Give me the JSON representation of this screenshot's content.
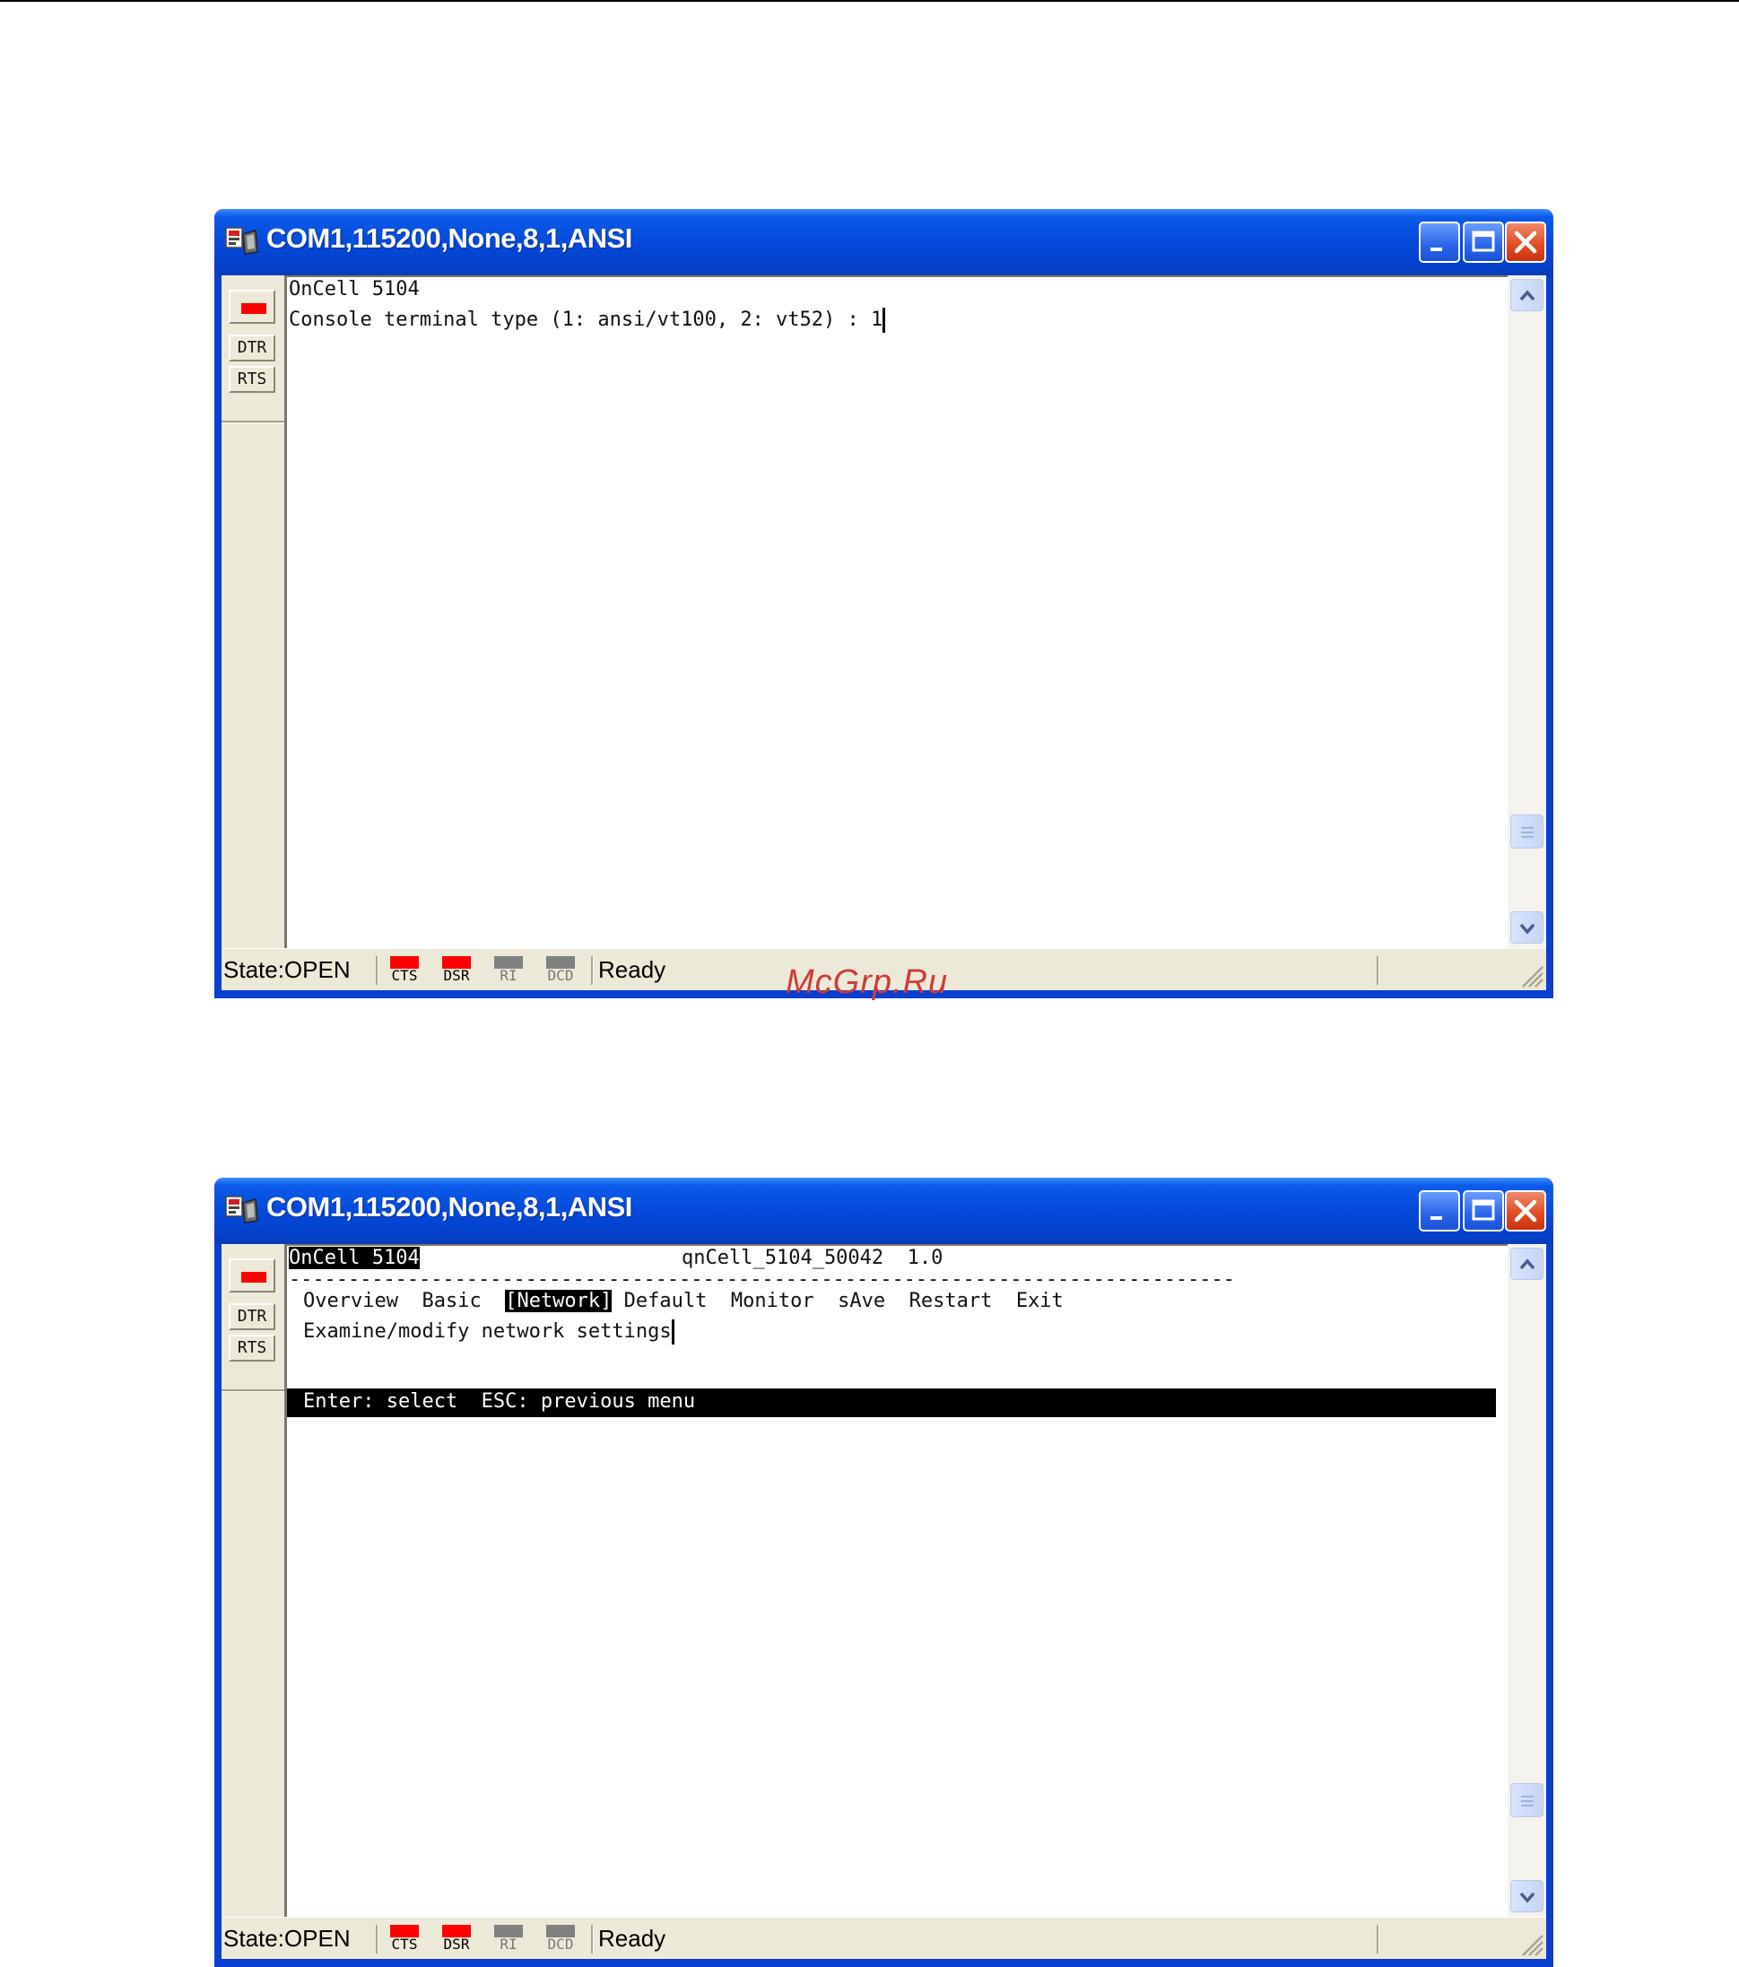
{
  "windows": [
    {
      "title": "COM1,115200,None,8,1,ANSI",
      "signals": {
        "dtr": "DTR",
        "rts": "RTS"
      },
      "terminal": {
        "line1": "OnCell 5104",
        "line2": "Console terminal type (1: ansi/vt100, 2: vt52) : 1"
      },
      "status": {
        "state": "State:OPEN",
        "indicators": [
          {
            "label": "CTS",
            "color": "#ff0000"
          },
          {
            "label": "DSR",
            "color": "#ff0000"
          },
          {
            "label": "RI",
            "color": "#808080"
          },
          {
            "label": "DCD",
            "color": "#808080"
          }
        ],
        "ready": "Ready"
      }
    },
    {
      "title": "COM1,115200,None,8,1,ANSI",
      "signals": {
        "dtr": "DTR",
        "rts": "RTS"
      },
      "terminal": {
        "header_left": "OnCell 5104",
        "header_right": "qnCell_5104_50042  1.0",
        "separator": "--------------------------------------------------------------------------------",
        "menu": [
          "Overview",
          "Basic",
          "[Network]",
          "Default",
          "Monitor",
          "sAve",
          "Restart",
          "Exit"
        ],
        "description": "Examine/modify network settings",
        "help": "Enter: select  ESC: previous menu"
      },
      "status": {
        "state": "State:OPEN",
        "indicators": [
          {
            "label": "CTS",
            "color": "#ff0000"
          },
          {
            "label": "DSR",
            "color": "#ff0000"
          },
          {
            "label": "RI",
            "color": "#808080"
          },
          {
            "label": "DCD",
            "color": "#808080"
          }
        ],
        "ready": "Ready"
      }
    }
  ],
  "watermark": "McGrp.Ru",
  "colors": {
    "titlebar": "#0448d8",
    "close_button": "#e04a20",
    "led_on": "#ff0000",
    "led_off": "#808080"
  }
}
